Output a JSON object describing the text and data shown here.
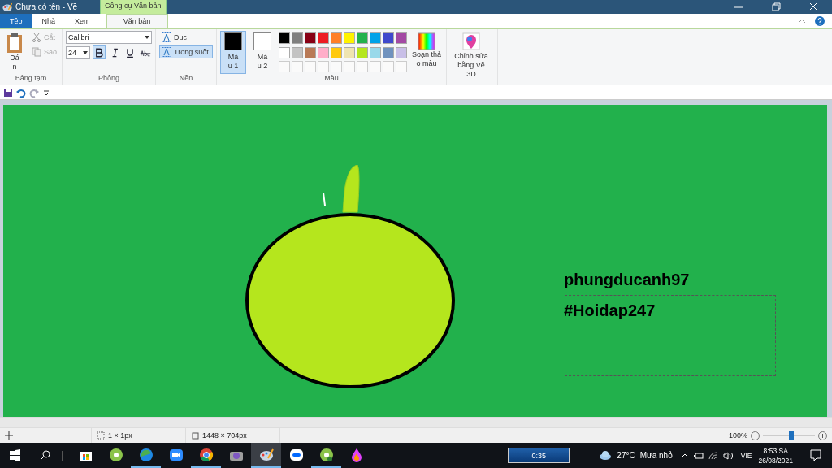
{
  "window": {
    "title": "Chưa có tên - Vẽ",
    "context_tab": "Công cụ Văn bản"
  },
  "tabs": [
    {
      "label": "Tệp",
      "kind": "file",
      "selected": false
    },
    {
      "label": "Nhà",
      "kind": "tab",
      "selected": false
    },
    {
      "label": "Xem",
      "kind": "tab",
      "selected": false
    },
    {
      "label": "Văn bản",
      "kind": "tab",
      "selected": true
    }
  ],
  "clipboard": {
    "label": "Bảng tạm",
    "paste": "Dán",
    "cut": {
      "label": "Cắt",
      "disabled": true
    },
    "copy": {
      "label": "Sao",
      "disabled": true
    }
  },
  "font": {
    "label": "Phông",
    "family": "Calibri",
    "size": "24",
    "styles": [
      {
        "kind": "bold",
        "selected": true
      },
      {
        "kind": "italic",
        "selected": false
      },
      {
        "kind": "underline",
        "selected": false
      },
      {
        "kind": "strike",
        "selected": false
      }
    ]
  },
  "background": {
    "label": "Nền",
    "options": [
      {
        "label": "Đục",
        "selected": false
      },
      {
        "label": "Trong suốt",
        "selected": true
      }
    ]
  },
  "colors": {
    "label": "Màu",
    "color1": {
      "label": "Màu 1",
      "color": "#000000",
      "selected": true
    },
    "color2": {
      "label": "Màu 2",
      "color": "#ffffff",
      "selected": false
    },
    "palette": [
      {
        "color": "#000000"
      },
      {
        "color": "#7f7f7f"
      },
      {
        "color": "#880015"
      },
      {
        "color": "#ed1c24"
      },
      {
        "color": "#ff7f27"
      },
      {
        "color": "#fff200"
      },
      {
        "color": "#22b14c"
      },
      {
        "color": "#00a2e8"
      },
      {
        "color": "#3f48cc"
      },
      {
        "color": "#a349a4"
      },
      {
        "color": "#ffffff"
      },
      {
        "color": "#c3c3c3"
      },
      {
        "color": "#b97a57"
      },
      {
        "color": "#ffaec9"
      },
      {
        "color": "#ffc90e"
      },
      {
        "color": "#efe4b0"
      },
      {
        "color": "#b5e61d"
      },
      {
        "color": "#99d9ea"
      },
      {
        "color": "#7092be"
      },
      {
        "color": "#c8bfe7"
      }
    ],
    "custom_slots": [
      {
        "kind": "empty"
      },
      {
        "kind": "empty"
      },
      {
        "kind": "empty"
      },
      {
        "kind": "empty"
      },
      {
        "kind": "empty"
      },
      {
        "kind": "empty"
      },
      {
        "kind": "empty"
      },
      {
        "kind": "empty"
      },
      {
        "kind": "empty"
      },
      {
        "kind": "empty"
      }
    ],
    "edit_colors": "Soạn thảo màu"
  },
  "paint3d": "Chỉnh sửa bằng Vẽ 3D",
  "canvas": {
    "texts": [
      "phungducanh97",
      "#Hoidap247"
    ]
  },
  "status_bar": {
    "selection": "1 × 1px",
    "size": "1448 × 704px",
    "zoom": "100%",
    "zoom_level": {
      "level": 0.55
    }
  },
  "taskbar": {
    "apps": [
      {
        "kind": "store",
        "running": false,
        "selected": false
      },
      {
        "kind": "greenapp",
        "running": false,
        "selected": false
      },
      {
        "kind": "edge",
        "running": true,
        "selected": false
      },
      {
        "kind": "zoom",
        "running": false,
        "selected": false
      },
      {
        "kind": "chrome",
        "running": true,
        "selected": false
      },
      {
        "kind": "camera",
        "running": false,
        "selected": false
      },
      {
        "kind": "paint",
        "running": true,
        "selected": true
      },
      {
        "kind": "zalo",
        "running": false,
        "selected": false
      },
      {
        "kind": "greenapp2",
        "running": true,
        "selected": false
      },
      {
        "kind": "drop",
        "running": false,
        "selected": false
      }
    ],
    "timer": "0:35",
    "temperature": "27°C",
    "weather": "Mưa nhỏ",
    "language": "VIE",
    "time": "8:53 SA",
    "date": "26/08/2021"
  }
}
